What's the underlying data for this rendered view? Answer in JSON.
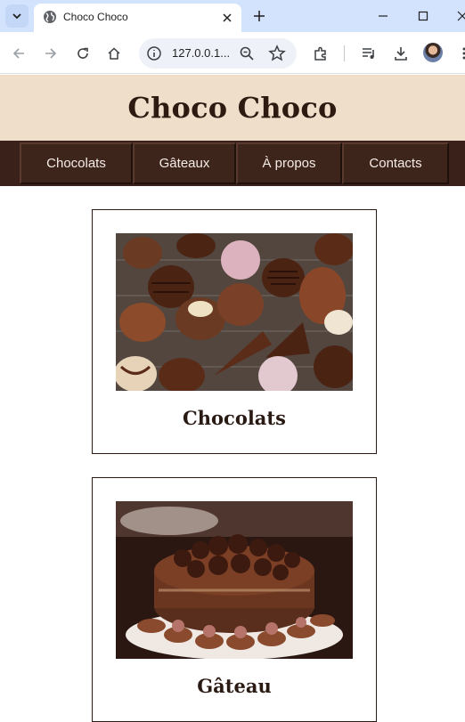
{
  "browser": {
    "tab_title": "Choco Choco",
    "url": "127.0.0.1...",
    "icons": [
      "tab-search-icon",
      "globe-icon",
      "close-icon",
      "plus-icon",
      "minimize-icon",
      "maximize-icon",
      "window-close-icon",
      "back-icon",
      "forward-icon",
      "reload-icon",
      "home-icon",
      "site-info-icon",
      "zoom-icon",
      "star-icon",
      "extensions-icon",
      "media-icon",
      "download-icon",
      "menu-icon"
    ]
  },
  "site": {
    "title": "Choco Choco"
  },
  "nav": {
    "items": [
      {
        "label": "Chocolats"
      },
      {
        "label": "Gâteaux"
      },
      {
        "label": "À propos"
      },
      {
        "label": "Contacts"
      }
    ]
  },
  "cards": [
    {
      "title": "Chocolats"
    },
    {
      "title": "Gâteau"
    }
  ],
  "colors": {
    "header_bg": "#efdfca",
    "nav_bg": "#3a221a",
    "title_text": "#2f1a12"
  }
}
